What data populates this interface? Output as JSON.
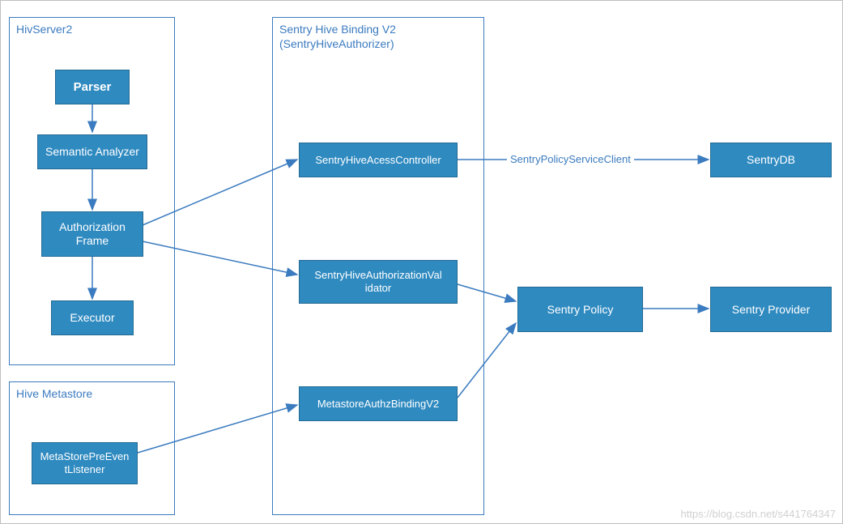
{
  "groups": {
    "hivserver2": {
      "title": "HivServer2"
    },
    "sentrybinding": {
      "title": "Sentry Hive Binding V2\n(SentryHiveAuthorizer)"
    },
    "metastore": {
      "title": "Hive Metastore"
    }
  },
  "nodes": {
    "parser": "Parser",
    "semantic": "Semantic Analyzer",
    "authframe": "Authorization\nFrame",
    "executor": "Executor",
    "metalistener": "MetaStorePreEven\ntListener",
    "accesscontroller": "SentryHiveAcessController",
    "authvalidator": "SentryHiveAuthorizationVal\nidator",
    "metabinding": "MetastoreAuthzBindingV2",
    "sentrydb": "SentryDB",
    "sentrypolicy": "Sentry Policy",
    "sentryprovider": "Sentry Provider"
  },
  "edge_labels": {
    "policyclient": "SentryPolicyServiceClient"
  },
  "watermark": "https://blog.csdn.net/s441764347",
  "arrow_color": "#3b7bbf"
}
